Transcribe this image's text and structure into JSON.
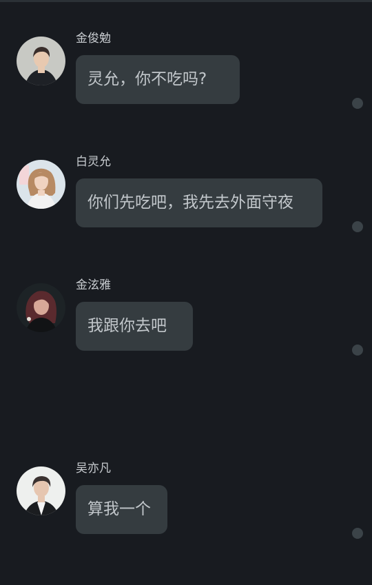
{
  "messages": [
    {
      "sender": "金俊勉",
      "text": "灵允，你不吃吗?",
      "avatar_icon": "avatar-boy-icon",
      "colors": {
        "bg": "#c8c9c4",
        "skin": "#e8c9b0",
        "hair": "#3a2e2b",
        "cloth": "#1e2126"
      }
    },
    {
      "sender": "白灵允",
      "text": "你们先吃吧，我先去外面守夜",
      "avatar_icon": "avatar-girl-icon",
      "colors": {
        "bg": "#dbe4ea",
        "skin": "#f0d3c0",
        "hair": "#b78a63",
        "cloth": "#f2f2f2"
      }
    },
    {
      "sender": "金泫雅",
      "text": "我跟你去吧",
      "avatar_icon": "avatar-girl-dark-icon",
      "colors": {
        "bg": "#1d2326",
        "skin": "#d7a898",
        "hair": "#5a2a2e",
        "cloth": "#111315"
      }
    },
    {
      "sender": "吴亦凡",
      "text": "算我一个",
      "avatar_icon": "avatar-man-icon",
      "colors": {
        "bg": "#eef0ee",
        "skin": "#e6c6b0",
        "hair": "#3b3230",
        "cloth": "#1b1d20"
      }
    }
  ]
}
